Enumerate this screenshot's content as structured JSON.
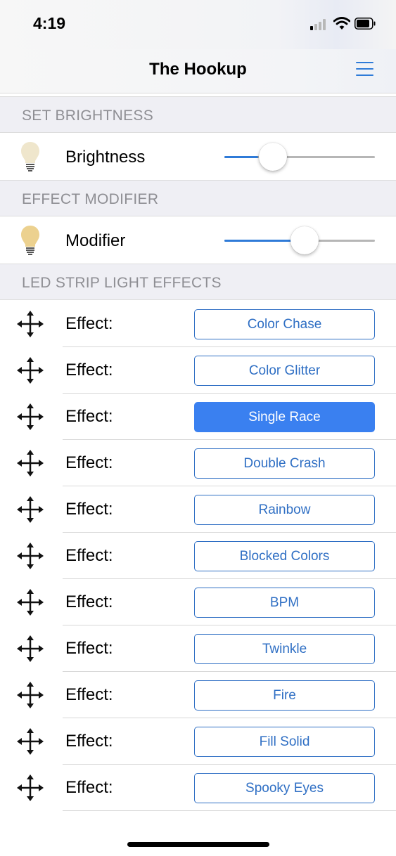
{
  "status_bar": {
    "time": "4:19"
  },
  "nav": {
    "title": "The Hookup",
    "menu_icon": "hamburger-menu-icon"
  },
  "sections": {
    "brightness": {
      "header": "SET BRIGHTNESS",
      "label": "Brightness",
      "icon": "light-bulb-icon",
      "slider_value": 0.25
    },
    "modifier": {
      "header": "EFFECT MODIFIER",
      "label": "Modifier",
      "icon": "light-bulb-icon",
      "slider_value": 0.5
    },
    "effects": {
      "header": "LED STRIP LIGHT EFFECTS",
      "row_label": "Effect:",
      "drag_icon": "move-arrows-icon",
      "items": [
        {
          "name": "Color Chase",
          "selected": false
        },
        {
          "name": "Color Glitter",
          "selected": false
        },
        {
          "name": "Single Race",
          "selected": true
        },
        {
          "name": "Double Crash",
          "selected": false
        },
        {
          "name": "Rainbow",
          "selected": false
        },
        {
          "name": "Blocked Colors",
          "selected": false
        },
        {
          "name": "BPM",
          "selected": false
        },
        {
          "name": "Twinkle",
          "selected": false
        },
        {
          "name": "Fire",
          "selected": false
        },
        {
          "name": "Fill Solid",
          "selected": false
        },
        {
          "name": "Spooky Eyes",
          "selected": false
        }
      ]
    }
  },
  "colors": {
    "accent": "#2f6fc4",
    "selected_button": "#3a80f0",
    "bulb_dim": "#efe6cc",
    "bulb_bright": "#ecd18f",
    "section_header_bg": "#efeff4"
  }
}
